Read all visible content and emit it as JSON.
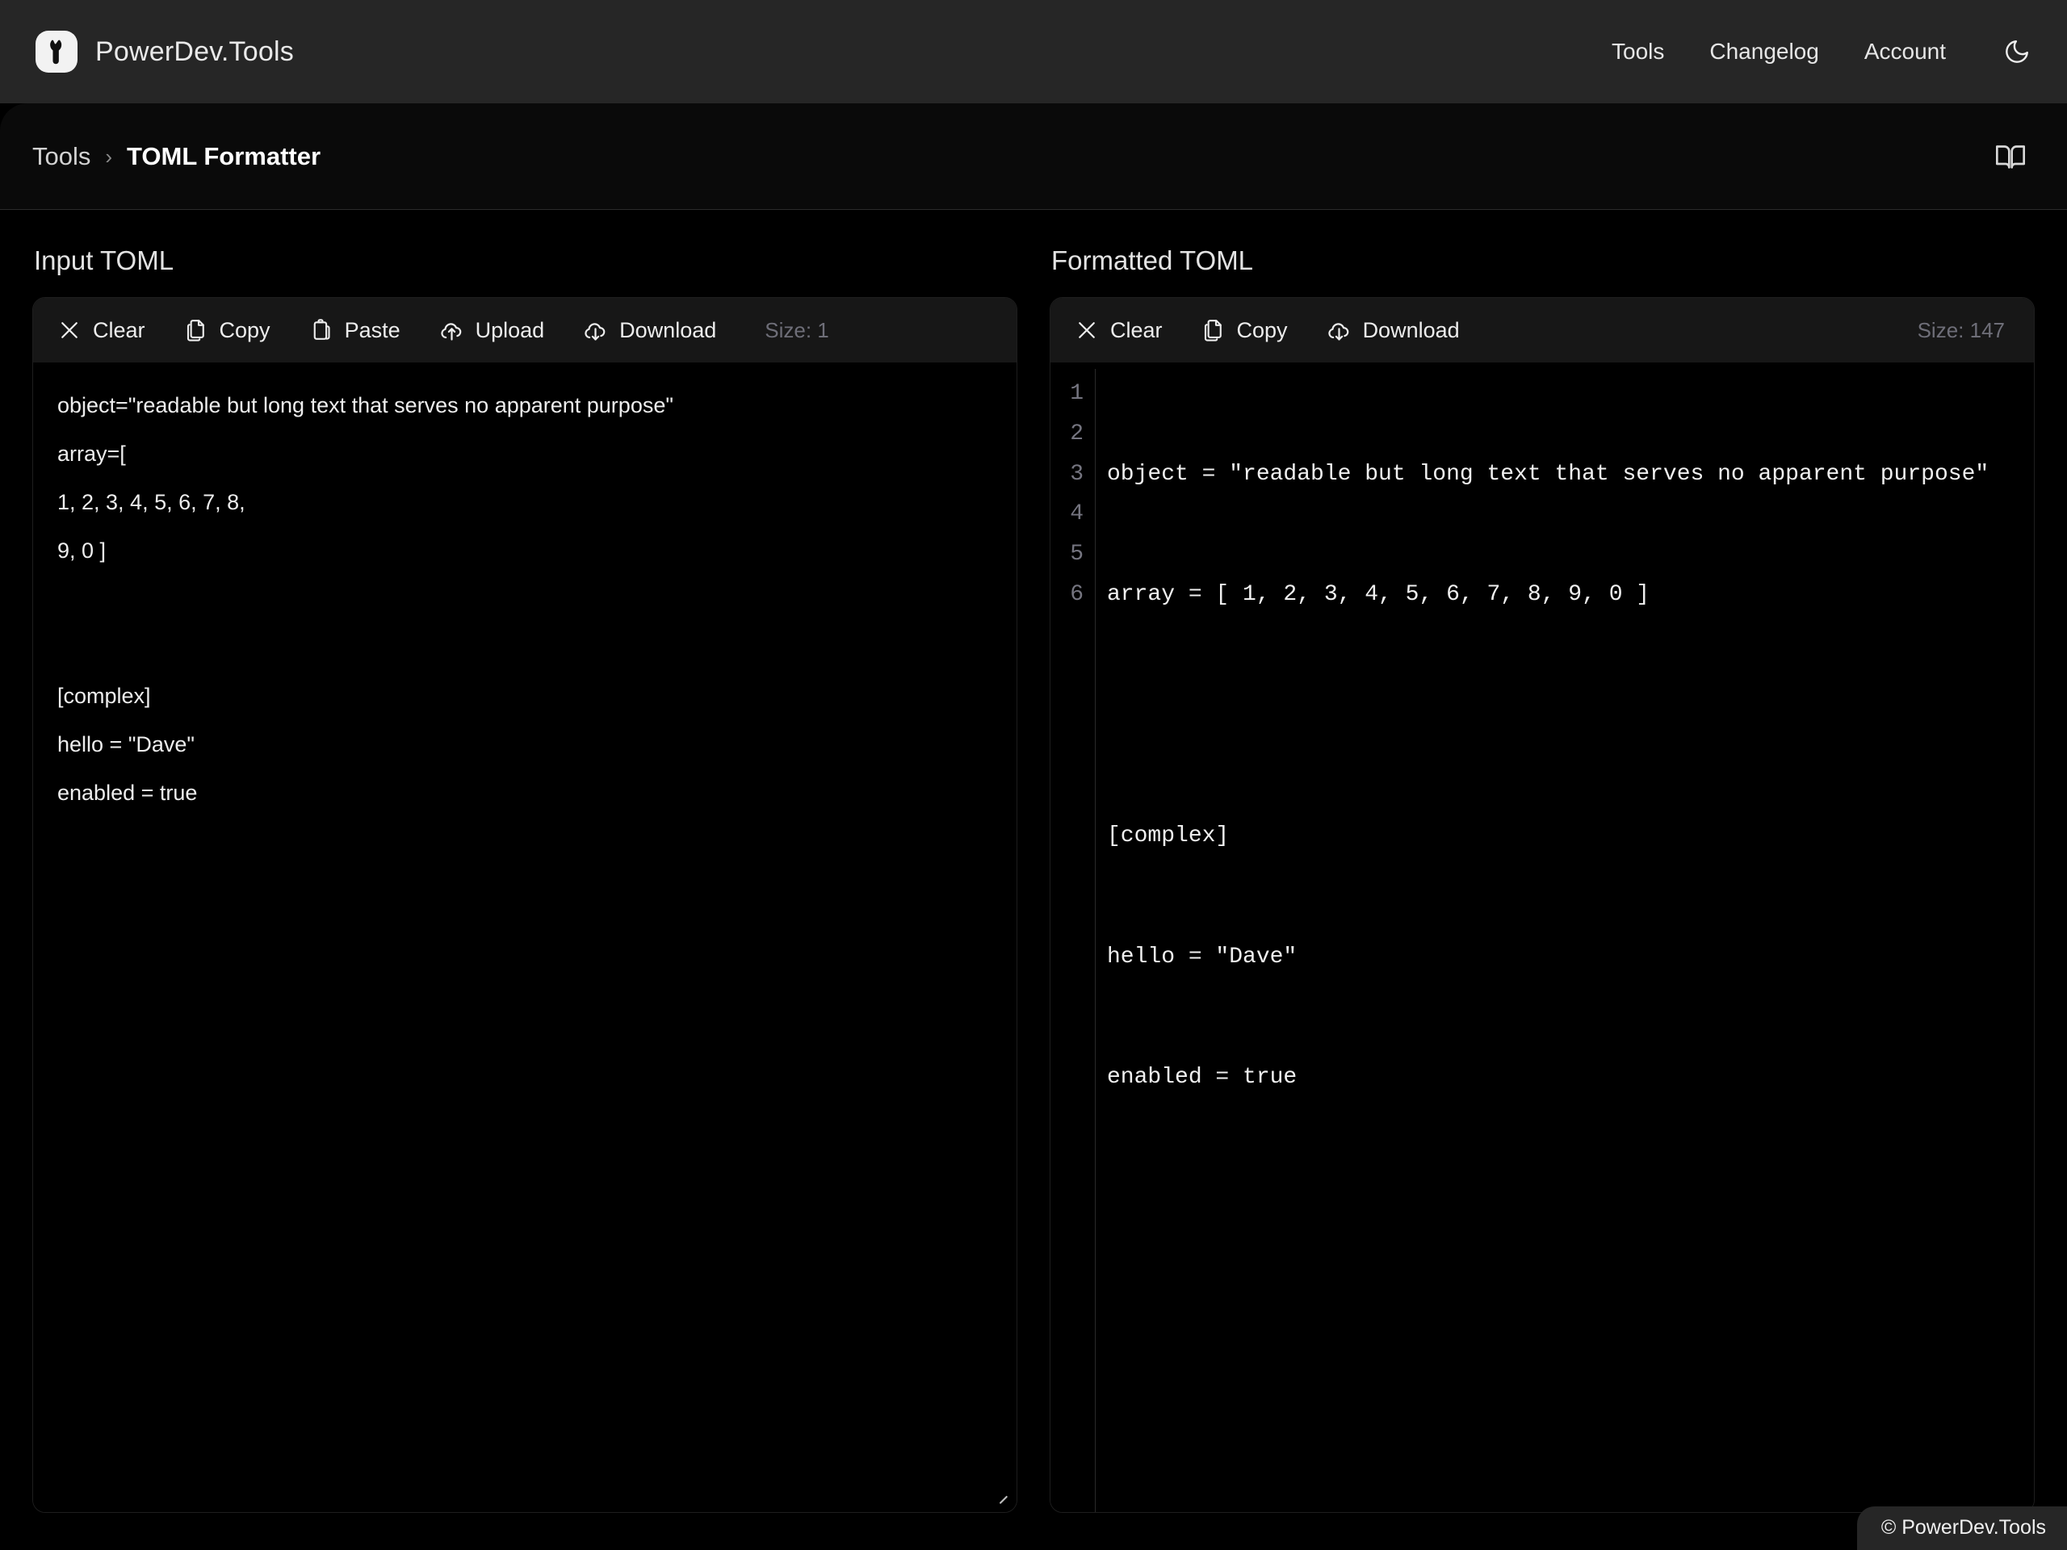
{
  "header": {
    "brand_name": "PowerDev.Tools",
    "logo_icon": "wrench-icon",
    "nav": [
      {
        "label": "Tools",
        "name": "tools"
      },
      {
        "label": "Changelog",
        "name": "changelog"
      },
      {
        "label": "Account",
        "name": "account"
      }
    ],
    "theme_toggle_icon": "moon-icon"
  },
  "breadcrumb": {
    "parent": "Tools",
    "separator": "›",
    "current": "TOML Formatter",
    "docs_icon": "book-icon"
  },
  "input_panel": {
    "title": "Input TOML",
    "toolbar": [
      {
        "label": "Clear",
        "icon": "close-icon",
        "name": "clear"
      },
      {
        "label": "Copy",
        "icon": "copy-icon",
        "name": "copy"
      },
      {
        "label": "Paste",
        "icon": "clipboard-icon",
        "name": "paste"
      },
      {
        "label": "Upload",
        "icon": "cloud-upload-icon",
        "name": "upload"
      },
      {
        "label": "Download",
        "icon": "cloud-download-icon",
        "name": "download"
      }
    ],
    "size_label": "Size: 1",
    "value": "object=\"readable but long text that serves no apparent purpose\"\narray=[\n1, 2, 3, 4, 5, 6, 7, 8,\n9, 0 ]\n\n\n[complex]\nhello = \"Dave\"\nenabled = true",
    "placeholder": ""
  },
  "output_panel": {
    "title": "Formatted TOML",
    "toolbar": [
      {
        "label": "Clear",
        "icon": "close-icon",
        "name": "clear"
      },
      {
        "label": "Copy",
        "icon": "copy-icon",
        "name": "copy"
      },
      {
        "label": "Download",
        "icon": "cloud-download-icon",
        "name": "download"
      }
    ],
    "size_label": "Size: 147",
    "lines": [
      {
        "number": "1",
        "text": "object = \"readable but long text that serves no apparent purpose\""
      },
      {
        "number": "2",
        "text": "array = [ 1, 2, 3, 4, 5, 6, 7, 8, 9, 0 ]"
      },
      {
        "number": "3",
        "text": ""
      },
      {
        "number": "4",
        "text": "[complex]"
      },
      {
        "number": "5",
        "text": "hello = \"Dave\""
      },
      {
        "number": "6",
        "text": "enabled = true"
      }
    ]
  },
  "footer": {
    "copyright": "© PowerDev.Tools"
  },
  "colors": {
    "page_background": "#000000",
    "header_background": "#262626",
    "toolbar_background": "#171717",
    "text_primary": "#ededed",
    "text_muted": "#6e6e78",
    "gutter_text": "#757580",
    "border": "#1e1e1e"
  }
}
